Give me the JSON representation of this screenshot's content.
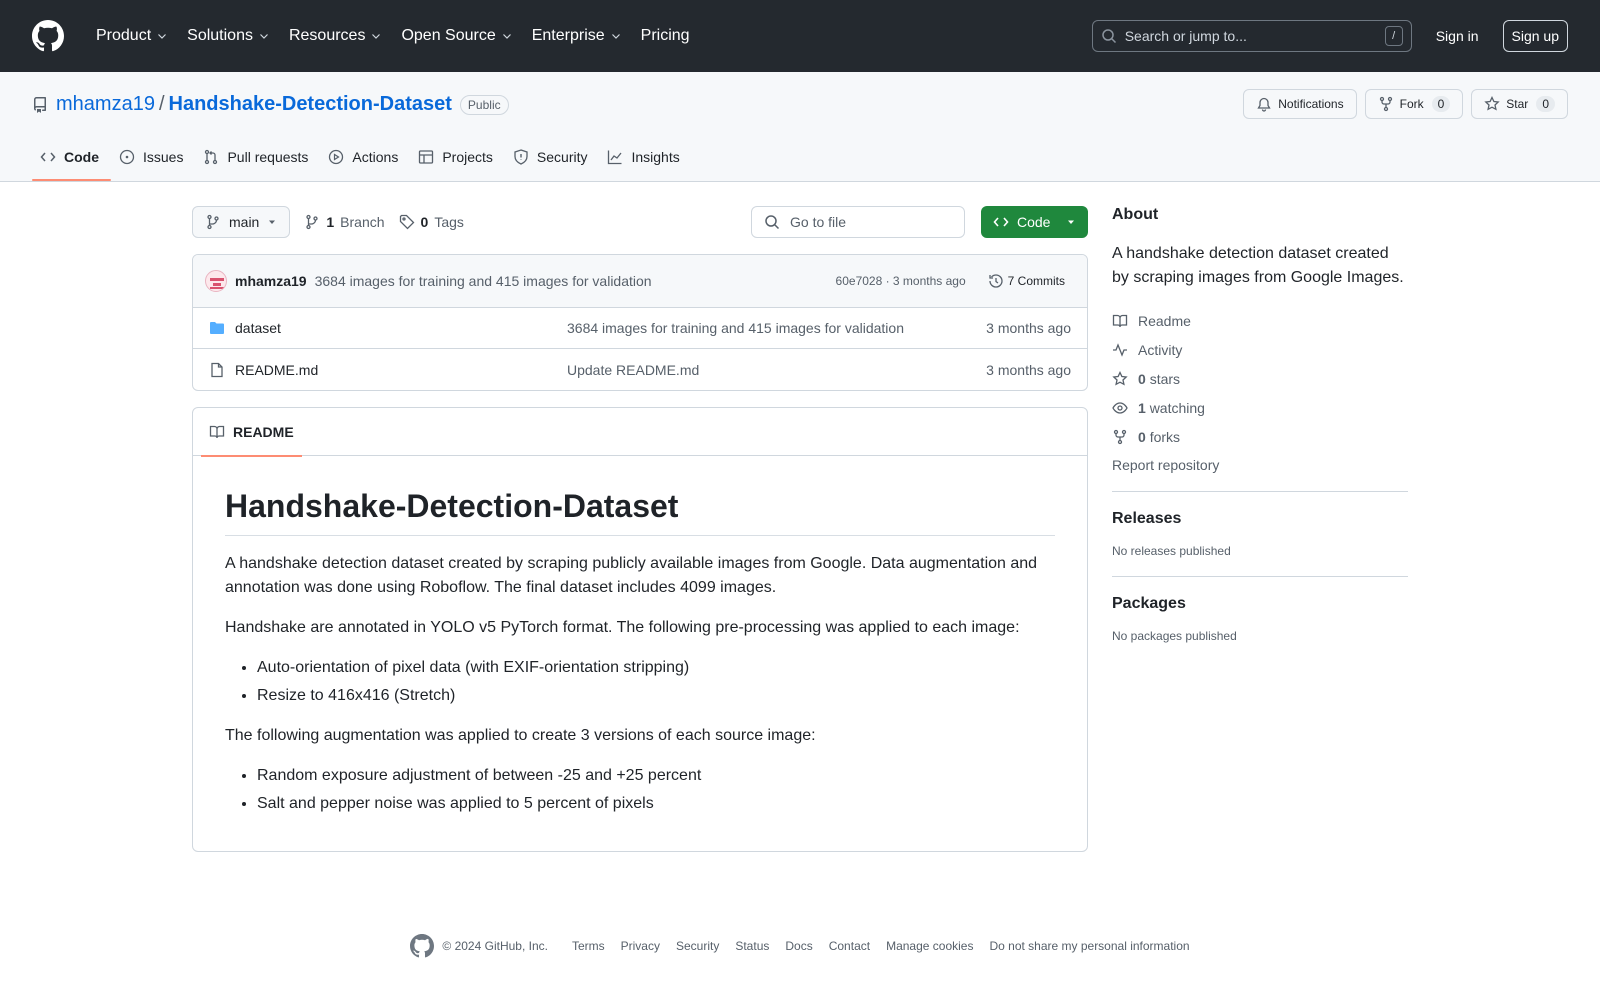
{
  "header": {
    "nav": [
      {
        "label": "Product",
        "dropdown": true
      },
      {
        "label": "Solutions",
        "dropdown": true
      },
      {
        "label": "Resources",
        "dropdown": true
      },
      {
        "label": "Open Source",
        "dropdown": true
      },
      {
        "label": "Enterprise",
        "dropdown": true
      },
      {
        "label": "Pricing",
        "dropdown": false
      }
    ],
    "search_placeholder": "Search or jump to...",
    "search_shortcut": "/",
    "sign_in": "Sign in",
    "sign_up": "Sign up"
  },
  "repo": {
    "owner": "mhamza19",
    "separator": "/",
    "name": "Handshake-Detection-Dataset",
    "visibility": "Public",
    "notifications_label": "Notifications",
    "fork_label": "Fork",
    "fork_count": "0",
    "star_label": "Star",
    "star_count": "0",
    "tabs": [
      {
        "label": "Code",
        "icon": "code-icon",
        "active": true
      },
      {
        "label": "Issues",
        "icon": "issue-icon",
        "active": false
      },
      {
        "label": "Pull requests",
        "icon": "pull-request-icon",
        "active": false
      },
      {
        "label": "Actions",
        "icon": "play-icon",
        "active": false
      },
      {
        "label": "Projects",
        "icon": "table-icon",
        "active": false
      },
      {
        "label": "Security",
        "icon": "shield-icon",
        "active": false
      },
      {
        "label": "Insights",
        "icon": "graph-icon",
        "active": false
      }
    ]
  },
  "toolbar": {
    "branch": "main",
    "branch_count": "1",
    "branch_label": "Branch",
    "tag_count": "0",
    "tag_label": "Tags",
    "goto_placeholder": "Go to file",
    "code_button": "Code"
  },
  "commit": {
    "author": "mhamza19",
    "message": "3684 images for training and 415 images for validation",
    "meta": "60e7028 · 3 months ago",
    "commits_label": "7 Commits"
  },
  "files": [
    {
      "name": "dataset",
      "type": "folder",
      "message": "3684 images for training and 415 images for validation",
      "age": "3 months ago"
    },
    {
      "name": "README.md",
      "type": "file",
      "message": "Update README.md",
      "age": "3 months ago"
    }
  ],
  "readme": {
    "tab_label": "README",
    "title": "Handshake-Detection-Dataset",
    "p1": "A handshake detection dataset created by scraping publicly available images from Google. Data augmentation and annotation was done using Roboflow. The final dataset includes 4099 images.",
    "p2": "Handshake are annotated in YOLO v5 PyTorch format. The following pre-processing was applied to each image:",
    "list1": [
      "Auto-orientation of pixel data (with EXIF-orientation stripping)",
      "Resize to 416x416 (Stretch)"
    ],
    "p3": "The following augmentation was applied to create 3 versions of each source image:",
    "list2": [
      "Random exposure adjustment of between -25 and +25 percent",
      "Salt and pepper noise was applied to 5 percent of pixels"
    ]
  },
  "about": {
    "heading": "About",
    "description": "A handshake detection dataset created by scraping images from Google Images.",
    "readme": "Readme",
    "activity": "Activity",
    "stars_count": "0",
    "stars_label": "stars",
    "watching_count": "1",
    "watching_label": "watching",
    "forks_count": "0",
    "forks_label": "forks",
    "report": "Report repository"
  },
  "releases": {
    "heading": "Releases",
    "sub": "No releases published"
  },
  "packages": {
    "heading": "Packages",
    "sub": "No packages published"
  },
  "footer": {
    "copyright": "© 2024 GitHub, Inc.",
    "links": [
      "Terms",
      "Privacy",
      "Security",
      "Status",
      "Docs",
      "Contact",
      "Manage cookies",
      "Do not share my personal information"
    ]
  },
  "colors": {
    "header_bg": "#24292f",
    "link": "#0969da",
    "primary_button": "#1f883d",
    "active_tab_underline": "#fd8c73"
  }
}
